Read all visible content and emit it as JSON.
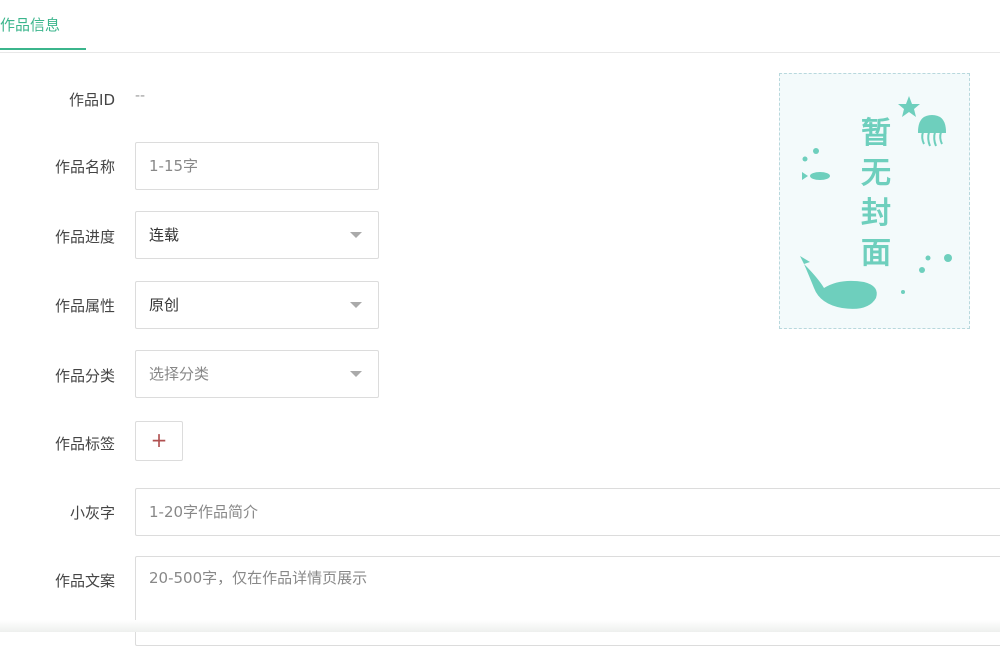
{
  "tabs": {
    "active_label": "作品信息"
  },
  "form": {
    "id": {
      "label": "作品ID",
      "value": "--"
    },
    "name": {
      "label": "作品名称",
      "placeholder": "1-15字"
    },
    "progress": {
      "label": "作品进度",
      "value": "连载"
    },
    "attribute": {
      "label": "作品属性",
      "value": "原创"
    },
    "category": {
      "label": "作品分类",
      "placeholder": "选择分类"
    },
    "tags": {
      "label": "作品标签",
      "add_symbol": "+"
    },
    "subtitle": {
      "label": "小灰字",
      "placeholder": "1-20字作品简介"
    },
    "copy": {
      "label": "作品文案",
      "placeholder": "20-500字，仅在作品详情页展示"
    }
  },
  "cover": {
    "text_chars": [
      "暂",
      "无",
      "封",
      "面"
    ],
    "accent_color": "#6ecfbd",
    "icons": [
      "star-icon",
      "jellyfish-icon",
      "fish-icon",
      "whale-icon",
      "bubble-icon"
    ]
  },
  "colors": {
    "brand": "#3bb58c",
    "border": "#dcdcdc"
  }
}
